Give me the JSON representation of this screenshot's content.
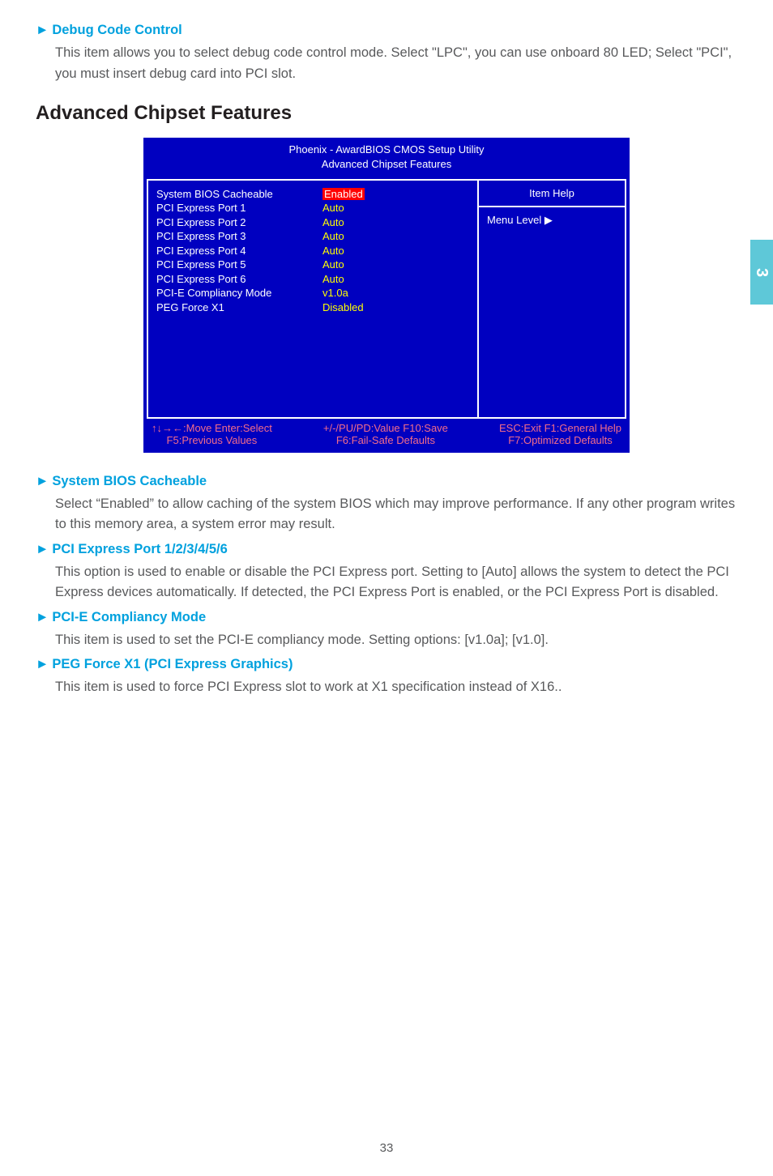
{
  "side_tab": "3",
  "page_number": "33",
  "sec1": {
    "heading": "Debug Code Control",
    "body": "This item allows you to select debug code control mode. Select \"LPC\", you can use onboard 80 LED; Select \"PCI\", you must insert debug card into PCI slot."
  },
  "h2": "Advanced Chipset Features",
  "bios": {
    "title_line1": "Phoenix - AwardBIOS CMOS Setup Utility",
    "title_line2": "Advanced Chipset Features",
    "rows": [
      {
        "label": "System BIOS Cacheable",
        "value": "Enabled",
        "highlight": true
      },
      {
        "label": "PCI Express Port 1",
        "value": "Auto"
      },
      {
        "label": "PCI Express Port 2",
        "value": "Auto"
      },
      {
        "label": "PCI Express Port 3",
        "value": "Auto"
      },
      {
        "label": "PCI Express Port 4",
        "value": "Auto"
      },
      {
        "label": "PCI Express Port 5",
        "value": "Auto"
      },
      {
        "label": "PCI Express Port 6",
        "value": "Auto"
      },
      {
        "label": "PCI-E Compliancy Mode",
        "value": "v1.0a"
      },
      {
        "label": "PEG Force X1",
        "value": "Disabled"
      }
    ],
    "item_help": "Item Help",
    "menu_level": "Menu Level  ▶",
    "footer": {
      "c1a": "↑↓→←:Move   Enter:Select",
      "c1b": "F5:Previous Values",
      "c2a": "+/-/PU/PD:Value   F10:Save",
      "c2b": "F6:Fail-Safe Defaults",
      "c3a": "ESC:Exit   F1:General Help",
      "c3b": "F7:Optimized Defaults"
    }
  },
  "sec2": {
    "heading": "System BIOS Cacheable",
    "body": "Select “Enabled” to allow caching of the system BIOS which may improve performance. If any other program writes to this memory area, a system error may result."
  },
  "sec3": {
    "heading": "PCI Express Port 1/2/3/4/5/6",
    "body": "This option is used to enable or disable the PCI Express port. Setting to [Auto] allows the system to detect the PCI Express devices automatically. If detected, the PCI Express Port is enabled, or the PCI Express Port is disabled."
  },
  "sec4": {
    "heading": "PCI-E Compliancy Mode",
    "body": "This item is used to set the PCI-E compliancy mode. Setting options: [v1.0a]; [v1.0]."
  },
  "sec5": {
    "heading": "PEG Force X1 (PCI Express Graphics)",
    "body": "This item is used to force PCI Express slot to work at  X1 specification instead of X16.."
  }
}
